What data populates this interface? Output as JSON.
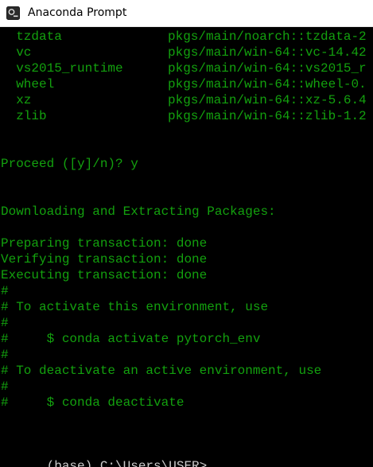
{
  "window": {
    "title": "Anaconda Prompt",
    "icon": "terminal-icon"
  },
  "colors": {
    "foreground": "#13a10e",
    "background": "#000000",
    "prompt": "#cccccc"
  },
  "packages": [
    {
      "name": "  tzdata",
      "source": "pkgs/main/noarch::tzdata-2"
    },
    {
      "name": "  vc",
      "source": "pkgs/main/win-64::vc-14.42"
    },
    {
      "name": "  vs2015_runtime",
      "source": "pkgs/main/win-64::vs2015_r"
    },
    {
      "name": "  wheel",
      "source": "pkgs/main/win-64::wheel-0."
    },
    {
      "name": "  xz",
      "source": "pkgs/main/win-64::xz-5.6.4"
    },
    {
      "name": "  zlib",
      "source": "pkgs/main/win-64::zlib-1.2"
    }
  ],
  "output": {
    "proceed": "Proceed ([y]/n)? y",
    "downloading": "Downloading and Extracting Packages:",
    "preparing": "Preparing transaction: done",
    "verifying": "Verifying transaction: done",
    "executing": "Executing transaction: done",
    "hash1": "#",
    "activate_note": "# To activate this environment, use",
    "hash2": "#",
    "activate_cmd": "#     $ conda activate pytorch_env",
    "hash3": "#",
    "deactivate_note": "# To deactivate an active environment, use",
    "hash4": "#",
    "deactivate_cmd": "#     $ conda deactivate"
  },
  "prompt": {
    "text": "(base) C:\\Users\\USER>"
  }
}
